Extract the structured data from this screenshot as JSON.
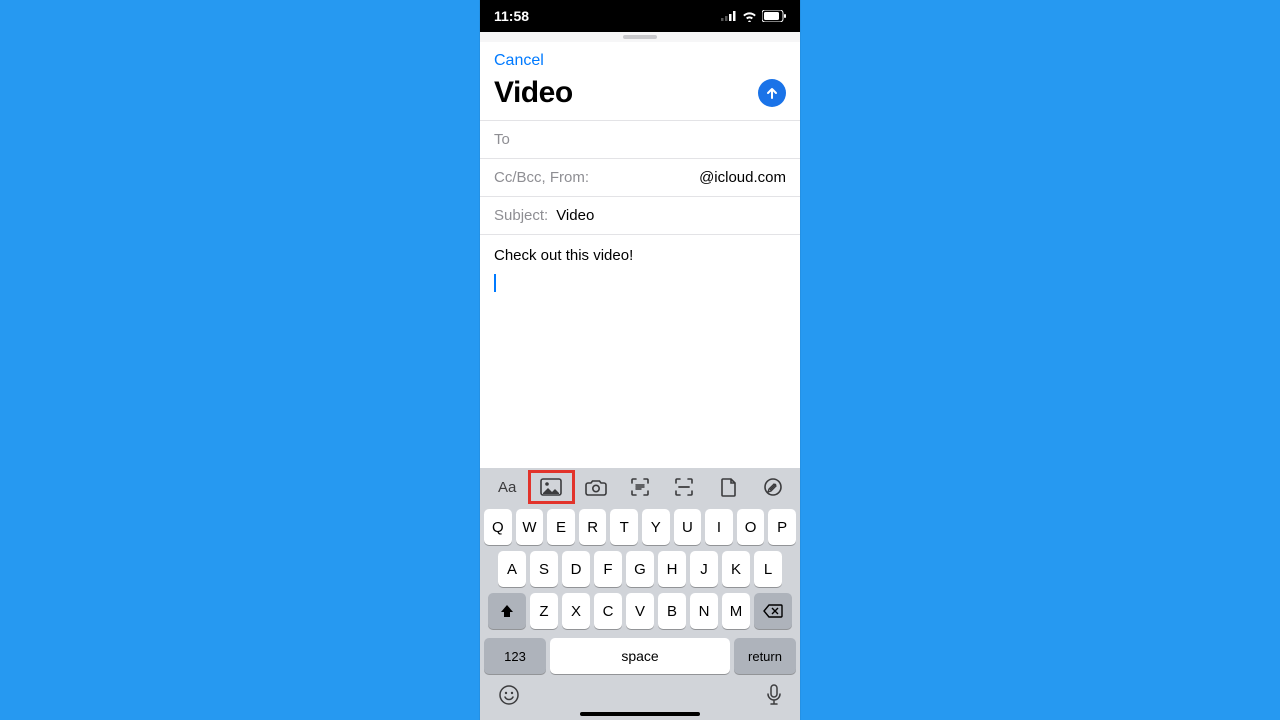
{
  "status": {
    "time": "11:58"
  },
  "compose": {
    "cancel": "Cancel",
    "title": "Video",
    "to_label": "To",
    "cc_label": "Cc/Bcc, From:",
    "from_value": "@icloud.com",
    "subject_label": "Subject:",
    "subject_value": "Video",
    "body": "Check out this video!"
  },
  "toolbar_icons": [
    "text-format",
    "photo",
    "camera",
    "scan-text",
    "scan-document",
    "file",
    "markup"
  ],
  "highlighted_tool": "photo",
  "keyboard": {
    "row1": [
      "Q",
      "W",
      "E",
      "R",
      "T",
      "Y",
      "U",
      "I",
      "O",
      "P"
    ],
    "row2": [
      "A",
      "S",
      "D",
      "F",
      "G",
      "H",
      "J",
      "K",
      "L"
    ],
    "row3": [
      "Z",
      "X",
      "C",
      "V",
      "B",
      "N",
      "M"
    ],
    "num_label": "123",
    "space_label": "space",
    "return_label": "return"
  }
}
